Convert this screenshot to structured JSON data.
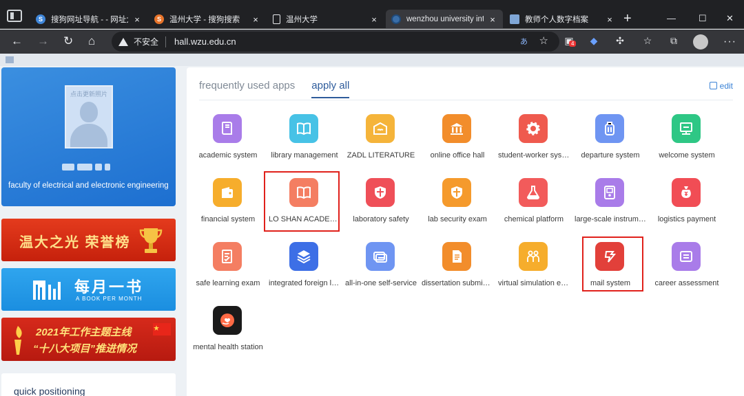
{
  "browser": {
    "tabs": [
      {
        "title": "搜狗网址导航 - - 网址大全",
        "favicon_color": "#3f86d9",
        "favicon_glyph": "S"
      },
      {
        "title": "温州大学 - 搜狗搜索",
        "favicon_color": "#e8742a",
        "favicon_glyph": "S"
      },
      {
        "title": "温州大学",
        "favicon_color": "#e8eaed",
        "favicon_glyph": ""
      },
      {
        "title": "wenzhou university intrane",
        "favicon_color": "#3a6ea8",
        "favicon_glyph": ""
      },
      {
        "title": "教师个人数字档案",
        "favicon_color": "#7fa6d6",
        "favicon_glyph": ""
      }
    ],
    "close_glyph": "×",
    "new_tab_glyph": "+",
    "security_label": "不安全",
    "url": "hall.wzu.edu.cn",
    "translate_glyph": "あ",
    "badge_count": "4",
    "window_controls": [
      "—",
      "☐",
      "✕"
    ]
  },
  "profile": {
    "photo_hint": "点击更新照片",
    "faculty": "faculty of electrical and electronic engineering"
  },
  "banners": {
    "honor": "温大之光 荣誉榜",
    "book_title": "每月一书",
    "book_subtitle": "A BOOK PER MONTH",
    "work_line1": "2021年工作主题主线",
    "work_line2": "“十八大项目”推进情况"
  },
  "quick_positioning": "quick positioning",
  "apps_panel": {
    "tabs": [
      {
        "label": "frequently used apps",
        "active": false
      },
      {
        "label": "apply all",
        "active": true
      }
    ],
    "edit_label": "edit",
    "apps": [
      {
        "label": "academic system",
        "color": "#a97ce9",
        "icon": "book"
      },
      {
        "label": "library management",
        "color": "#47c2e6",
        "icon": "open-book"
      },
      {
        "label": "ZADL LITERATURE",
        "color": "#f5b43a",
        "icon": "envelope-book"
      },
      {
        "label": "online office hall",
        "color": "#f28d2b",
        "icon": "bank"
      },
      {
        "label": "student-worker system",
        "color": "#ef5a4e",
        "icon": "gear"
      },
      {
        "label": "departure system",
        "color": "#6f95f2",
        "icon": "luggage"
      },
      {
        "label": "welcome system",
        "color": "#2ec785",
        "icon": "board"
      },
      {
        "label": "financial system",
        "color": "#f6ad2c",
        "icon": "wallet"
      },
      {
        "label": "LO SHAN ACADEMY",
        "color": "#f47e62",
        "icon": "open-book"
      },
      {
        "label": "laboratory safety",
        "color": "#ef4f58",
        "icon": "shield"
      },
      {
        "label": "lab security exam",
        "color": "#f59a2c",
        "icon": "shield"
      },
      {
        "label": "chemical platform",
        "color": "#f25b5b",
        "icon": "flask"
      },
      {
        "label": "large-scale instrument",
        "color": "#a97ce9",
        "icon": "device"
      },
      {
        "label": "logistics payment",
        "color": "#f14d55",
        "icon": "moneybag"
      },
      {
        "label": "safe learning exam",
        "color": "#f47e62",
        "icon": "doc-edit"
      },
      {
        "label": "integrated foreign language",
        "color": "#3d6fe6",
        "icon": "layers"
      },
      {
        "label": "all-in-one self-service",
        "color": "#6f95f2",
        "icon": "cards"
      },
      {
        "label": "dissertation submission",
        "color": "#f28d2b",
        "icon": "doc"
      },
      {
        "label": "virtual simulation experiment",
        "color": "#f6ad2c",
        "icon": "people"
      },
      {
        "label": "mail system",
        "color": "#e2403a",
        "icon": "mail-yi"
      },
      {
        "label": "career assessment",
        "color": "#a97ce9",
        "icon": "list"
      },
      {
        "label": "mental health station",
        "color": "#1a1a1a",
        "icon": "heart-hand"
      }
    ]
  }
}
